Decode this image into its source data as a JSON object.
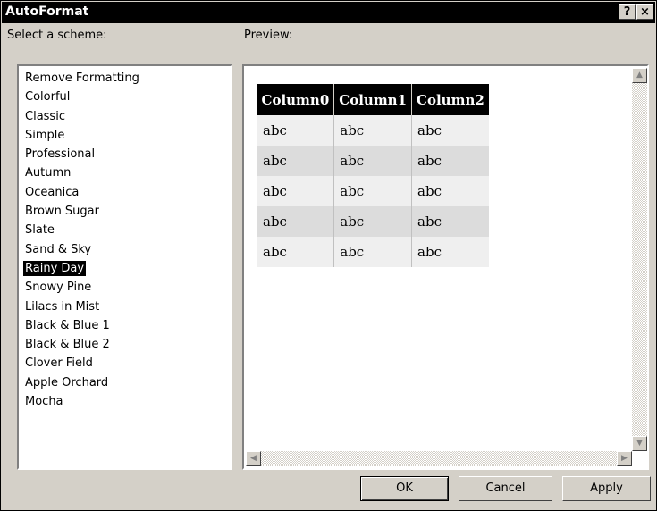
{
  "window": {
    "title": "AutoFormat"
  },
  "titlebar": {
    "help": "?",
    "close": "×"
  },
  "labels": {
    "scheme": "Select a scheme:",
    "preview": "Preview:"
  },
  "schemes": [
    "Remove Formatting",
    "Colorful",
    "Classic",
    "Simple",
    "Professional",
    "Autumn",
    "Oceanica",
    "Brown Sugar",
    "Slate",
    "Sand & Sky",
    "Rainy Day",
    "Snowy Pine",
    "Lilacs in Mist",
    "Black & Blue 1",
    "Black & Blue 2",
    "Clover Field",
    "Apple Orchard",
    "Mocha"
  ],
  "selected_scheme": "Rainy Day",
  "preview": {
    "headers": [
      "Column0",
      "Column1",
      "Column2"
    ],
    "rows": [
      [
        "abc",
        "abc",
        "abc"
      ],
      [
        "abc",
        "abc",
        "abc"
      ],
      [
        "abc",
        "abc",
        "abc"
      ],
      [
        "abc",
        "abc",
        "abc"
      ],
      [
        "abc",
        "abc",
        "abc"
      ]
    ]
  },
  "buttons": {
    "ok": "OK",
    "cancel": "Cancel",
    "apply": "Apply"
  }
}
